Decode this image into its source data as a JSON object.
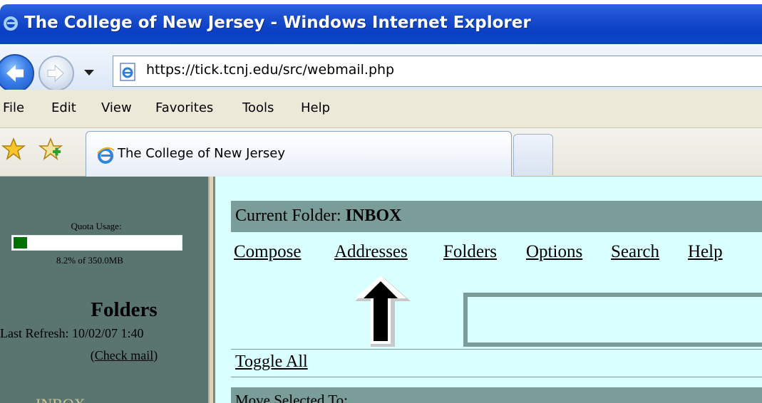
{
  "window": {
    "title": "The College of New Jersey - Windows Internet Explorer"
  },
  "address_bar": {
    "url": "https://tick.tcnj.edu/src/webmail.php"
  },
  "menu_bar": {
    "items": [
      "File",
      "Edit",
      "View",
      "Favorites",
      "Tools",
      "Help"
    ]
  },
  "tabs": {
    "active_label": "The College of New Jersey"
  },
  "sidebar": {
    "quota_label": "Quota Usage:",
    "quota_fraction": 0.082,
    "quota_text": "8.2% of 350.0MB",
    "folders_title": "Folders",
    "last_refresh": "Last Refresh: 10/02/07 1:40",
    "check_mail_open": "(",
    "check_mail_label": "Check mail",
    "check_mail_close": ")",
    "inbox_label": "INBOX"
  },
  "main": {
    "current_folder_label": "Current Folder:",
    "current_folder_name": "INBOX",
    "menu_links": [
      "Compose",
      "Addresses",
      "Folders",
      "Options",
      "Search",
      "Help"
    ],
    "toggle_all_label": "Toggle All",
    "move_selected_label": "Move Selected To:"
  },
  "colors": {
    "title_bar_blue": "#0a3fc4",
    "sidebar_bg": "#5a7570",
    "main_bg": "#d9ffff",
    "folder_bar": "#7a9d9a",
    "quota_fill": "#007000"
  },
  "icons": [
    "ie-logo-icon",
    "back-arrow-icon",
    "forward-arrow-icon",
    "dropdown-icon",
    "page-icon",
    "favorites-star-icon",
    "add-favorites-icon",
    "annotation-arrow-icon"
  ]
}
